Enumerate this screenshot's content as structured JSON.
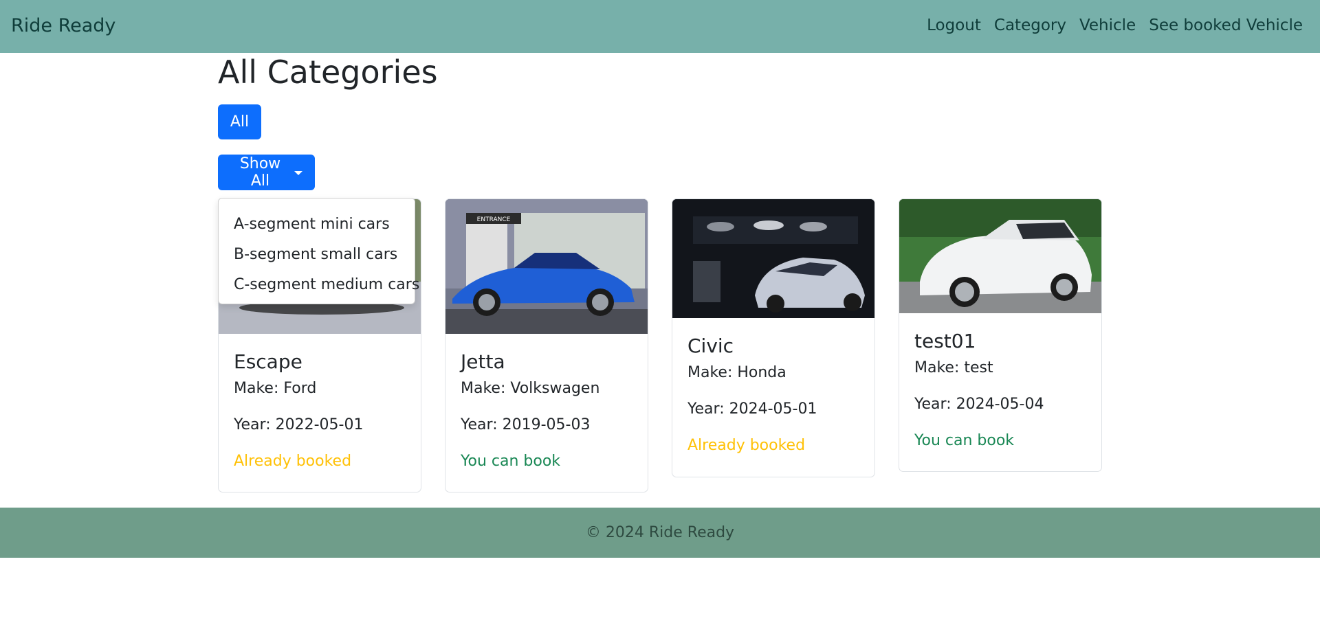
{
  "nav": {
    "brand": "Ride Ready",
    "links": [
      "Logout",
      "Category",
      "Vehicle",
      "See booked Vehicle"
    ]
  },
  "main": {
    "title": "All Categories",
    "filter_all_label": "All",
    "show_all_label": "Show All",
    "dropdown_options": [
      "A-segment mini cars",
      "B-segment small cars",
      "C-segment medium cars"
    ]
  },
  "vehicles": [
    {
      "name": "Escape",
      "make": "Make: Ford",
      "year": "Year: 2022-05-01",
      "status": "Already booked",
      "status_type": "booked",
      "image": "white-suv-photo"
    },
    {
      "name": "Jetta",
      "make": "Make: Volkswagen",
      "year": "Year: 2019-05-03",
      "status": "You can book",
      "status_type": "available",
      "image": "blue-coupe-photo"
    },
    {
      "name": "Civic",
      "make": "Make: Honda",
      "year": "Year: 2024-05-01",
      "status": "Already booked",
      "status_type": "booked",
      "image": "silver-camaro-photo"
    },
    {
      "name": "test01",
      "make": "Make: test",
      "year": "Year: 2024-05-04",
      "status": "You can book",
      "status_type": "available",
      "image": "white-range-rover-photo"
    }
  ],
  "footer": {
    "text": "© 2024 Ride Ready"
  },
  "colors": {
    "navbar": "#77b0aa",
    "footer": "#6f9d8a",
    "primary": "#0d6efd",
    "booked": "#ffc107",
    "available": "#198754"
  }
}
